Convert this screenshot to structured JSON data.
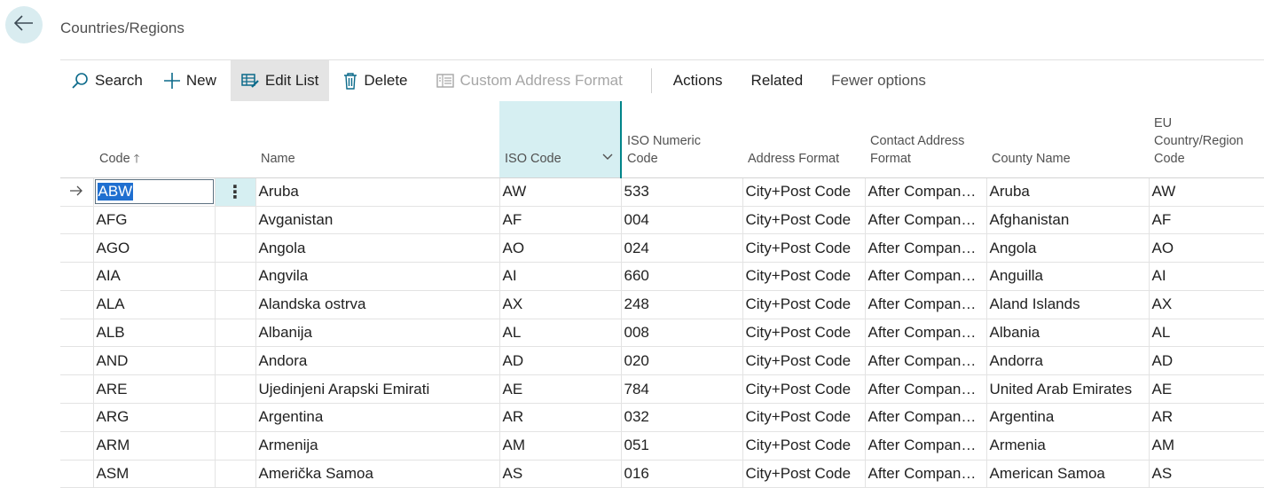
{
  "header": {
    "back_icon": "arrow-left-icon",
    "title": "Countries/Regions"
  },
  "toolbar": {
    "search": "Search",
    "new": "New",
    "edit_list": "Edit List",
    "delete": "Delete",
    "custom_address_format": "Custom Address Format",
    "actions": "Actions",
    "related": "Related",
    "fewer_options": "Fewer options"
  },
  "columns": {
    "code": "Code",
    "name": "Name",
    "iso_code": "ISO Code",
    "iso_numeric_1": "ISO Numeric",
    "iso_numeric_2": "Code",
    "address_format": "Address Format",
    "contact_1": "Contact Address",
    "contact_2": "Format",
    "county_name": "County Name",
    "eu_1": "EU",
    "eu_2": "Country/Region",
    "eu_3": "Code"
  },
  "rows": [
    {
      "code": "ABW",
      "name": "Aruba",
      "iso": "AW",
      "num": "533",
      "addr": "City+Post Code",
      "contact": "After Company Name",
      "county": "Aruba",
      "eu": "AW"
    },
    {
      "code": "AFG",
      "name": "Avganistan",
      "iso": "AF",
      "num": "004",
      "addr": "City+Post Code",
      "contact": "After Company Name",
      "county": "Afghanistan",
      "eu": "AF"
    },
    {
      "code": "AGO",
      "name": "Angola",
      "iso": "AO",
      "num": "024",
      "addr": "City+Post Code",
      "contact": "After Company Name",
      "county": "Angola",
      "eu": "AO"
    },
    {
      "code": "AIA",
      "name": "Angvila",
      "iso": "AI",
      "num": "660",
      "addr": "City+Post Code",
      "contact": "After Company Name",
      "county": "Anguilla",
      "eu": "AI"
    },
    {
      "code": "ALA",
      "name": "Alandska ostrva",
      "iso": "AX",
      "num": "248",
      "addr": "City+Post Code",
      "contact": "After Company Name",
      "county": "Aland Islands",
      "eu": "AX"
    },
    {
      "code": "ALB",
      "name": "Albanija",
      "iso": "AL",
      "num": "008",
      "addr": "City+Post Code",
      "contact": "After Company Name",
      "county": "Albania",
      "eu": "AL"
    },
    {
      "code": "AND",
      "name": "Andora",
      "iso": "AD",
      "num": "020",
      "addr": "City+Post Code",
      "contact": "After Company Name",
      "county": "Andorra",
      "eu": "AD"
    },
    {
      "code": "ARE",
      "name": "Ujedinjeni Arapski Emirati",
      "iso": "AE",
      "num": "784",
      "addr": "City+Post Code",
      "contact": "After Company Name",
      "county": "United Arab Emirates",
      "eu": "AE"
    },
    {
      "code": "ARG",
      "name": "Argentina",
      "iso": "AR",
      "num": "032",
      "addr": "City+Post Code",
      "contact": "After Company Name",
      "county": "Argentina",
      "eu": "AR"
    },
    {
      "code": "ARM",
      "name": "Armenija",
      "iso": "AM",
      "num": "051",
      "addr": "City+Post Code",
      "contact": "After Company Name",
      "county": "Armenia",
      "eu": "AM"
    },
    {
      "code": "ASM",
      "name": "Američka Samoa",
      "iso": "AS",
      "num": "016",
      "addr": "City+Post Code",
      "contact": "After Company Name",
      "county": "American Samoa",
      "eu": "AS"
    }
  ],
  "colors": {
    "accent": "#008489",
    "selected_column_bg": "#d6eff2",
    "selection_highlight": "#1f6fd0"
  }
}
